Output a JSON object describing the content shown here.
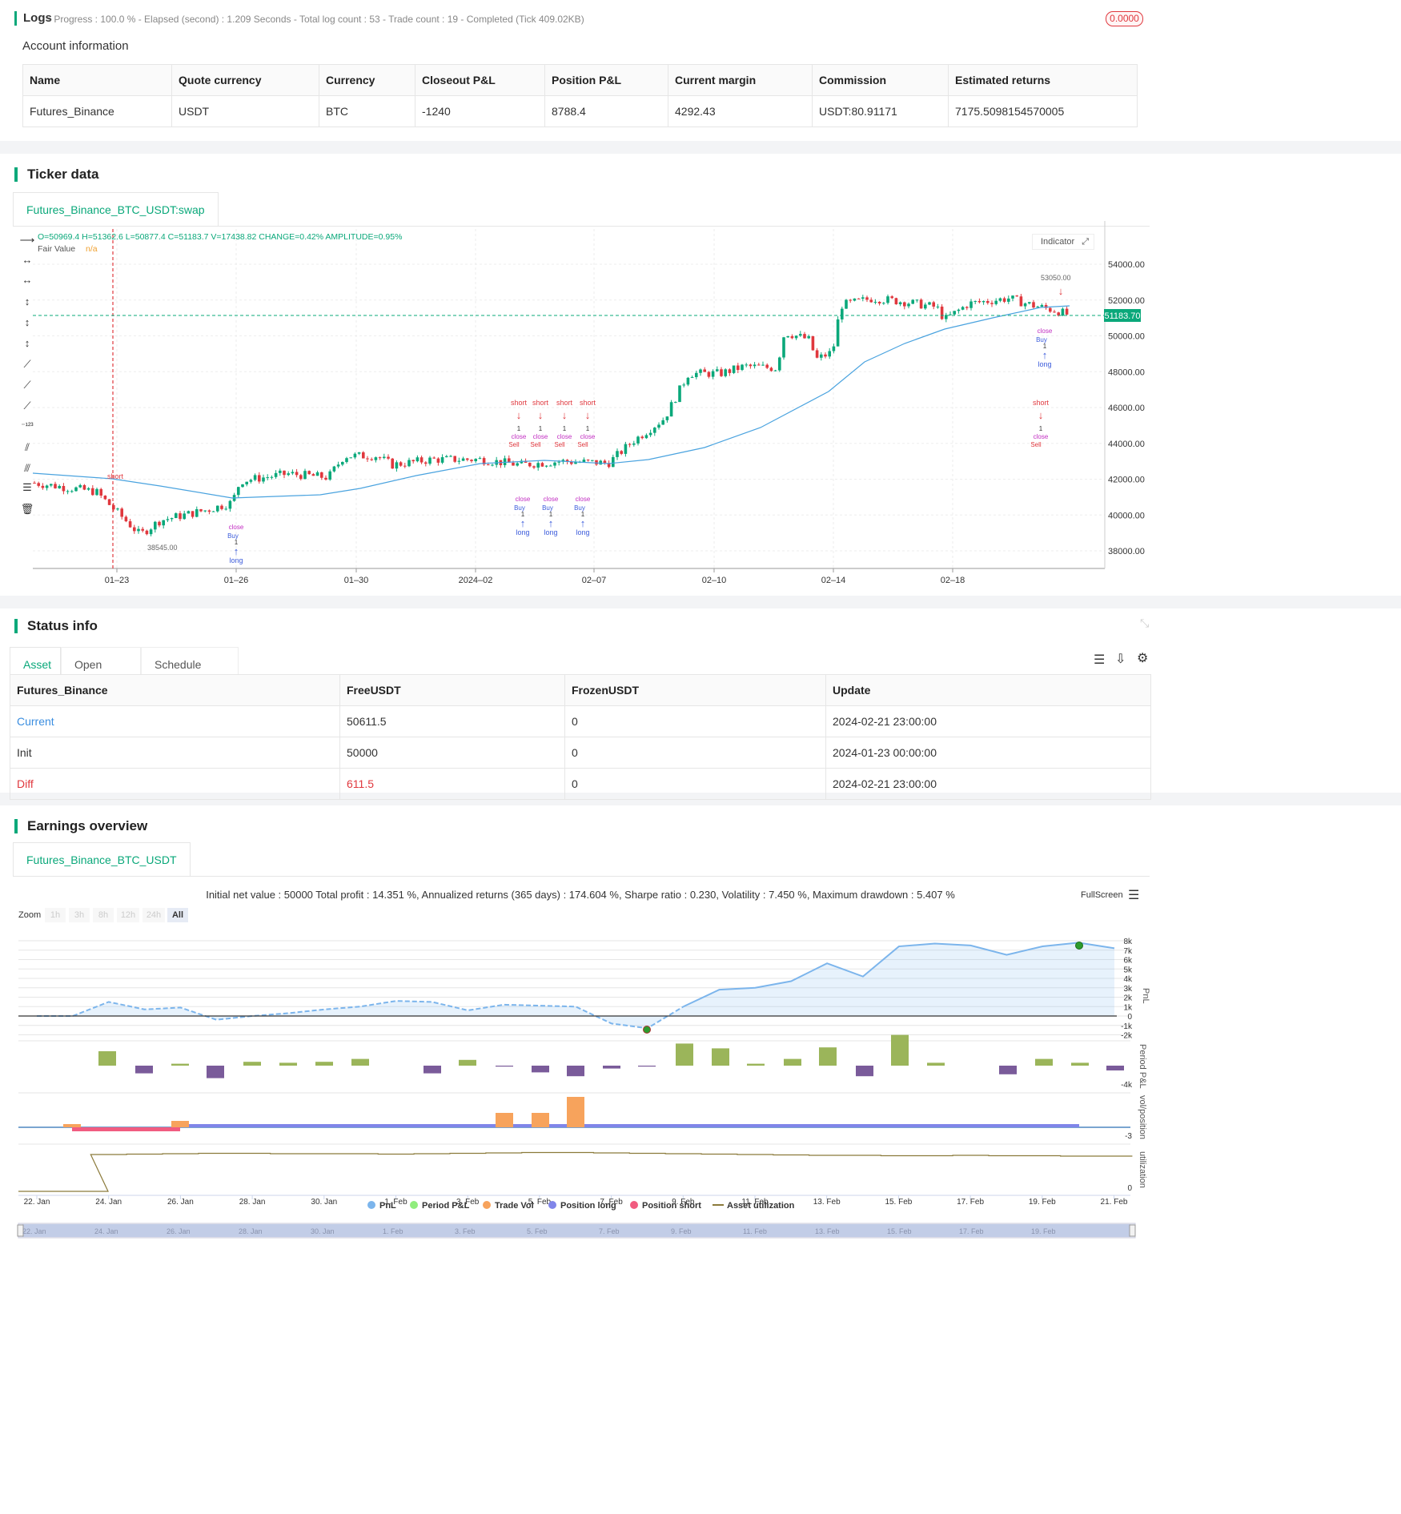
{
  "logs": {
    "title": "Logs",
    "status": "- Progress : 100.0 % - Elapsed (second) : 1.209  Seconds - Total log count : 53 - Trade count : 19 - Completed (Tick 409.02KB)",
    "badge": "0.0000"
  },
  "account": {
    "title": "Account information",
    "columns": [
      "Name",
      "Quote currency",
      "Currency",
      "Closeout P&L",
      "Position P&L",
      "Current margin",
      "Commission",
      "Estimated returns"
    ],
    "row": [
      "Futures_Binance",
      "USDT",
      "BTC",
      "-1240",
      "8788.4",
      "4292.43",
      "USDT:80.91171",
      "7175.5098154570005"
    ]
  },
  "ticker": {
    "title": "Ticker data",
    "tab": "Futures_Binance_BTC_USDT:swap",
    "ohlc": "O=50969.4 H=51362.6 L=50877.4 C=51183.7 V=17438.82 CHANGE=0.42% AMPLITUDE=0.95%",
    "fair_value_label": "Fair Value",
    "fair_value": "n/a",
    "indicator_btn": "Indicator",
    "price_tag": "51183.70",
    "low_marker": "38545.00",
    "high_marker": "53050.00",
    "y_ticks": [
      "54000.00",
      "52000.00",
      "50000.00",
      "48000.00",
      "46000.00",
      "44000.00",
      "42000.00",
      "40000.00",
      "38000.00"
    ],
    "x_ticks": [
      "01–23",
      "01–26",
      "01–30",
      "2024–02",
      "02–07",
      "02–10",
      "02–14",
      "02–18"
    ],
    "trade_labels": {
      "short": "short",
      "long": "long",
      "buy": "Buy",
      "sell": "Sell",
      "close": "close",
      "qty": "1"
    }
  },
  "status": {
    "title": "Status info",
    "tabs": [
      "Asset",
      "Open orders",
      "Schedule orders"
    ],
    "columns": [
      "Futures_Binance",
      "FreeUSDT",
      "FrozenUSDT",
      "Update"
    ],
    "rows": [
      [
        "Current",
        "50611.5",
        "0",
        "2024-02-21 23:00:00"
      ],
      [
        "Init",
        "50000",
        "0",
        "2024-01-23 00:00:00"
      ],
      [
        "Diff",
        "611.5",
        "0",
        "2024-02-21 23:00:00"
      ]
    ],
    "colors": {
      "current": "#3b8ee0",
      "diff": "#e0383e"
    }
  },
  "earnings": {
    "title": "Earnings overview",
    "tab": "Futures_Binance_BTC_USDT",
    "summary": "Initial net value : 50000 Total profit : 14.351 %, Annualized returns (365 days) : 174.604 %, Sharpe ratio : 0.230, Volatility : 7.450 %, Maximum drawdown : 5.407 %",
    "fullscreen": "FullScreen",
    "zoom_label": "Zoom",
    "zoom_options": [
      "1h",
      "3h",
      "8h",
      "12h",
      "24h",
      "All"
    ],
    "pnl_ticks": [
      "8k",
      "7k",
      "6k",
      "5k",
      "4k",
      "3k",
      "2k",
      "1k",
      "0",
      "-1k",
      "-2k"
    ],
    "axis_titles": [
      "PnL",
      "Period P&L",
      "vol/position",
      "utilization"
    ],
    "period_tick": "-4k",
    "vol_tick": "-3",
    "util_tick": "0",
    "x_ticks": [
      "22. Jan",
      "24. Jan",
      "26. Jan",
      "28. Jan",
      "30. Jan",
      "1. Feb",
      "3. Feb",
      "5. Feb",
      "7. Feb",
      "9. Feb",
      "11. Feb",
      "13. Feb",
      "15. Feb",
      "17. Feb",
      "19. Feb",
      "21. Feb"
    ],
    "legend": [
      "PnL",
      "Period P&L",
      "Trade Vol",
      "Position long",
      "Position short",
      "Asset utilization"
    ],
    "legend_colors": [
      "#7cb5ec",
      "#90ed7d",
      "#f7a35c",
      "#8085e9",
      "#f15c80",
      "#8b7a3a"
    ],
    "navigator_ticks": [
      "22. Jan",
      "24. Jan",
      "26. Jan",
      "28. Jan",
      "30. Jan",
      "1. Feb",
      "3. Feb",
      "5. Feb",
      "7. Feb",
      "9. Feb",
      "11. Feb",
      "13. Feb",
      "15. Feb",
      "17. Feb",
      "19. Feb"
    ]
  },
  "chart_data": [
    {
      "type": "line",
      "title": "",
      "ylabel": "PnL",
      "x": [
        "22. Jan",
        "23. Jan",
        "24. Jan",
        "25. Jan",
        "26. Jan",
        "27. Jan",
        "28. Jan",
        "29. Jan",
        "30. Jan",
        "31. Jan",
        "1. Feb",
        "2. Feb",
        "3. Feb",
        "4. Feb",
        "5. Feb",
        "6. Feb",
        "7. Feb",
        "8. Feb",
        "9. Feb",
        "10. Feb",
        "11. Feb",
        "12. Feb",
        "13. Feb",
        "14. Feb",
        "15. Feb",
        "16. Feb",
        "17. Feb",
        "18. Feb",
        "19. Feb",
        "20. Feb",
        "21. Feb"
      ],
      "series": [
        {
          "name": "PnL",
          "values": [
            0,
            0,
            1500,
            700,
            900,
            -400,
            0,
            300,
            700,
            1000,
            1600,
            1500,
            600,
            1200,
            1100,
            1000,
            -800,
            -1300,
            1000,
            2800,
            3000,
            3700,
            5600,
            4200,
            7400,
            7700,
            7500,
            6500,
            7400,
            7800,
            7200
          ]
        }
      ],
      "ylim": [
        -2000,
        8000
      ]
    },
    {
      "type": "bar",
      "ylabel": "Period P&L",
      "categories": [
        "24. Jan",
        "25. Jan",
        "26. Jan",
        "27. Jan",
        "28. Jan",
        "29. Jan",
        "30. Jan",
        "31. Jan",
        "2. Feb",
        "3. Feb",
        "4. Feb",
        "5. Feb",
        "6. Feb",
        "7. Feb",
        "8. Feb",
        "9. Feb",
        "10. Feb",
        "11. Feb",
        "12. Feb",
        "13. Feb",
        "14. Feb",
        "15. Feb",
        "16. Feb",
        "18. Feb",
        "19. Feb",
        "20. Feb",
        "21. Feb"
      ],
      "values": [
        1500,
        -800,
        200,
        -1300,
        400,
        300,
        400,
        700,
        -800,
        600,
        -100,
        -700,
        -1100,
        -300,
        -100,
        2300,
        1800,
        200,
        700,
        1900,
        -1100,
        3200,
        300,
        -900,
        700,
        300,
        -500
      ]
    },
    {
      "type": "bar",
      "ylabel": "vol/position",
      "series": [
        {
          "name": "Trade Vol",
          "values": [
            {
              "x": "23. Jan",
              "y": 1
            },
            {
              "x": "26. Jan",
              "y": 1
            },
            {
              "x": "4. Feb",
              "y": 2
            },
            {
              "x": "5. Feb",
              "y": 2
            },
            {
              "x": "6. Feb",
              "y": 4
            }
          ]
        },
        {
          "name": "Position long",
          "values": [
            {
              "x": "26. Jan",
              "y": 0.5
            },
            {
              "x": "20. Feb",
              "y": 0.5
            }
          ]
        },
        {
          "name": "Position short",
          "values": [
            {
              "x": "23. Jan",
              "y": -0.5
            },
            {
              "x": "26. Jan",
              "y": -0.5
            }
          ]
        }
      ]
    },
    {
      "type": "line",
      "ylabel": "utilization",
      "series": [
        {
          "name": "Asset utilization",
          "values": [
            0,
            0,
            0.92,
            0.93,
            0.94,
            0.95,
            0.95,
            0.94,
            0.94,
            0.94,
            0.93,
            0.94,
            0.95,
            0.96,
            0.97,
            0.97,
            0.96,
            0.95,
            0.94,
            0.93,
            0.92,
            0.91,
            0.9,
            0.9,
            0.89,
            0.89,
            0.9,
            0.89,
            0.89,
            0.88,
            0.88
          ]
        }
      ]
    }
  ]
}
